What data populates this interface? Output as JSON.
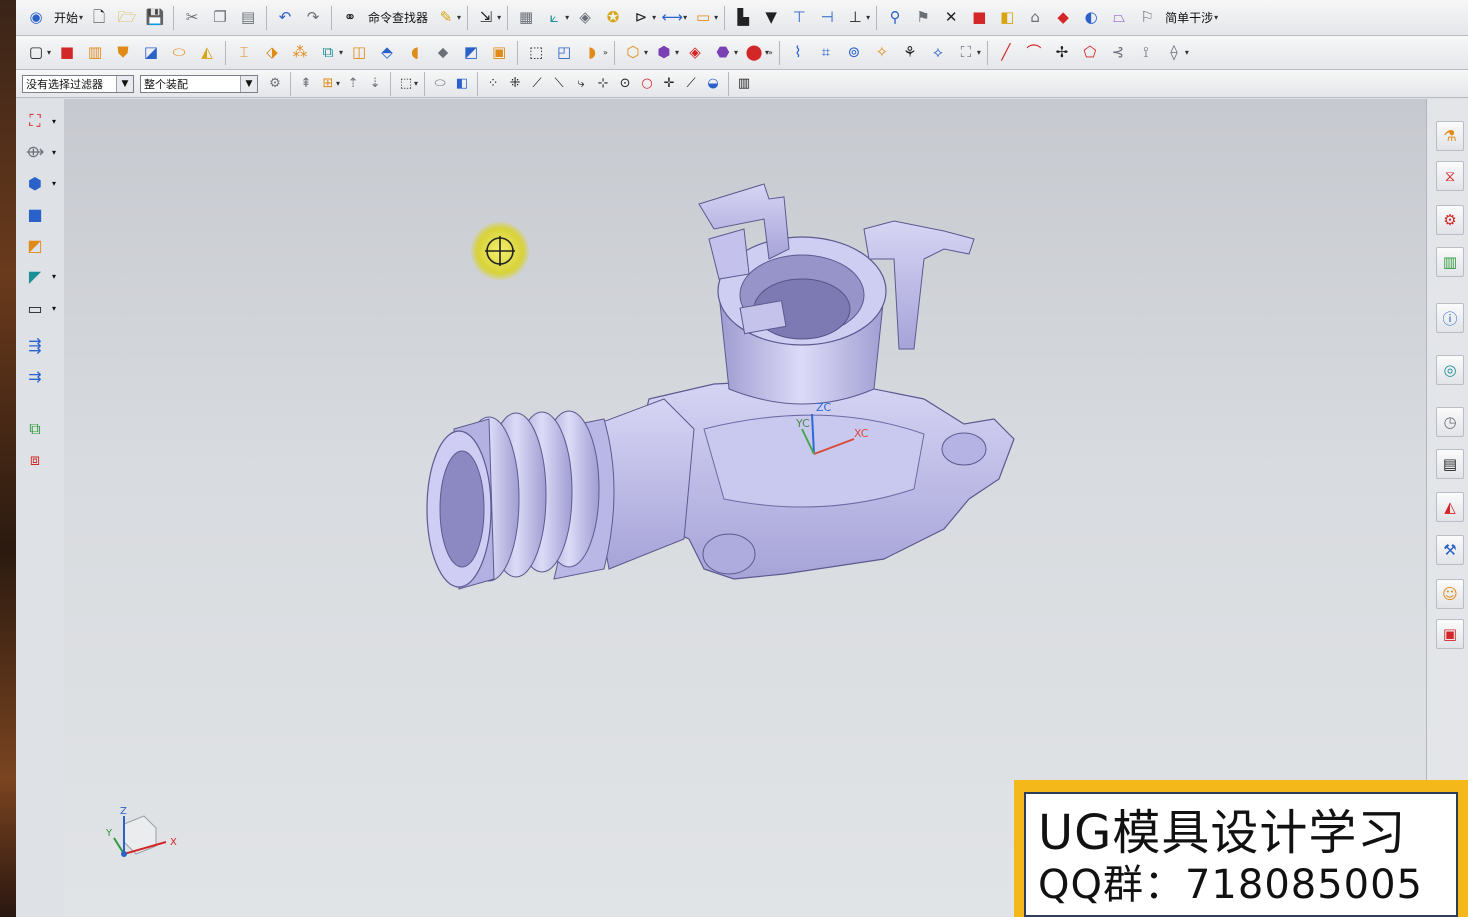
{
  "toolbar_main": {
    "start_label": "开始",
    "command_finder_label": "命令查找器",
    "simple_interference_label": "简单干涉"
  },
  "selection_bar": {
    "filter_value": "没有选择过滤器",
    "scope_value": "整个装配"
  },
  "viewport": {
    "wcs_labels": {
      "xc": "XC",
      "yc": "YC",
      "zc": "ZC"
    },
    "triad_labels": {
      "x": "X",
      "y": "Y",
      "z": "Z"
    }
  },
  "promo": {
    "title": "UG模具设计学习",
    "subtitle": "QQ群：718085005"
  },
  "colors": {
    "part_body": "#b8b6e6",
    "background_top": "#c6c9cf",
    "background_bottom": "#e1e4e6",
    "promo_border": "#f4b81a"
  }
}
